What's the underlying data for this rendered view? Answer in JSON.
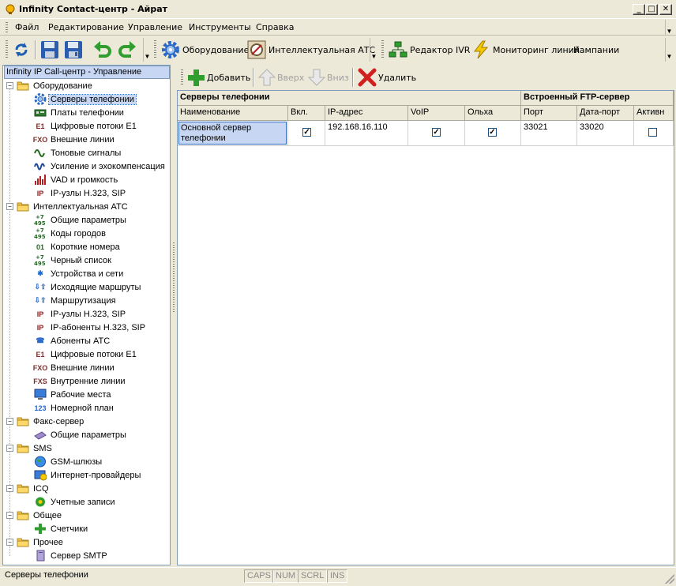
{
  "window": {
    "title": "Infinity Contact-центр  - Айрат",
    "minimize": "_",
    "maximize": "□",
    "close": "✕"
  },
  "menu": [
    "Файл",
    "Редактирование",
    "Управление",
    "Инструменты",
    "Справка"
  ],
  "toolbar": {
    "equipment": "Оборудование",
    "pbx": "Интеллектуальная АТС",
    "ivr": "Редактор IVR",
    "monitoring": "Мониторинг линий",
    "campaigns": "Кампании"
  },
  "tree": {
    "header": "Infinity IP Call-центр - Управление",
    "groups": [
      {
        "label": "Оборудование",
        "items": [
          {
            "label": "Серверы телефонии",
            "icon": "gear-icon",
            "selected": true
          },
          {
            "label": "Платы телефонии",
            "icon": "board-icon"
          },
          {
            "label": "Цифровые потоки E1",
            "icon": "e1-icon",
            "glyph": "E1"
          },
          {
            "label": "Внешние линии",
            "icon": "fxo-icon",
            "glyph": "FXO"
          },
          {
            "label": "Тоновые сигналы",
            "icon": "tone-wave-icon"
          },
          {
            "label": "Усиление и эхокомпенсация",
            "icon": "echo-icon"
          },
          {
            "label": "VAD и громкость",
            "icon": "volume-icon"
          },
          {
            "label": "IP-узлы H.323, SIP",
            "icon": "ip-icon",
            "glyph": "IP"
          }
        ]
      },
      {
        "label": "Интеллектуальная АТС",
        "items": [
          {
            "label": "Общие параметры",
            "icon": "code-495-icon"
          },
          {
            "label": "Коды городов",
            "icon": "code-495-icon"
          },
          {
            "label": "Короткие номера",
            "icon": "short-number-icon",
            "glyph": "01"
          },
          {
            "label": "Черный список",
            "icon": "code-495-icon"
          },
          {
            "label": "Устройства и сети",
            "icon": "asterisk-icon",
            "glyph": "✱"
          },
          {
            "label": "Исходящие маршруты",
            "icon": "route-icon",
            "glyph": "⇩⇧"
          },
          {
            "label": "Маршрутизация",
            "icon": "route-icon",
            "glyph": "⇩⇧"
          },
          {
            "label": "IP-узлы H.323, SIP",
            "icon": "ip-icon",
            "glyph": "IP"
          },
          {
            "label": "IP-абоненты H.323, SIP",
            "icon": "ip-phone-icon",
            "glyph": "IP"
          },
          {
            "label": "Абоненты АТС",
            "icon": "phone-icon",
            "glyph": "☎"
          },
          {
            "label": "Цифровые потоки E1",
            "icon": "e1-icon",
            "glyph": "E1"
          },
          {
            "label": "Внешние линии",
            "icon": "fxo-icon",
            "glyph": "FXO"
          },
          {
            "label": "Внутренние линии",
            "icon": "fxs-icon",
            "glyph": "FXS"
          },
          {
            "label": "Рабочие места",
            "icon": "monitor-icon"
          },
          {
            "label": "Номерной план",
            "icon": "number-plan-icon",
            "glyph": "123"
          }
        ]
      },
      {
        "label": "Факс-сервер",
        "items": [
          {
            "label": "Общие параметры",
            "icon": "fax-icon"
          }
        ]
      },
      {
        "label": "SMS",
        "items": [
          {
            "label": "GSM-шлюзы",
            "icon": "globe-icon"
          },
          {
            "label": "Интернет-провайдеры",
            "icon": "globe-monitor-icon"
          }
        ]
      },
      {
        "label": "ICQ",
        "items": [
          {
            "label": "Учетные записи",
            "icon": "icq-flower-icon"
          }
        ]
      },
      {
        "label": "Общее",
        "items": [
          {
            "label": "Счетчики",
            "icon": "plus-icon"
          }
        ]
      },
      {
        "label": "Прочее",
        "items": [
          {
            "label": "Сервер SMTP",
            "icon": "server-icon"
          }
        ]
      }
    ]
  },
  "actions": {
    "add": "Добавить",
    "up": "Вверх",
    "down": "Вниз",
    "delete": "Удалить"
  },
  "grid": {
    "group_servers": "Серверы телефонии",
    "group_ftp": "Встроенный FTP-сервер",
    "columns": [
      "Наименование",
      "Вкл.",
      "IP-адрес",
      "VoIP",
      "Ольха",
      "Порт",
      "Дата-порт",
      "Активн"
    ],
    "rows": [
      {
        "name": "Основной сервер телефонии",
        "enabled": true,
        "ip": "192.168.16.110",
        "voip": true,
        "olkha": true,
        "port": "33021",
        "data_port": "33020",
        "active": false
      }
    ]
  },
  "status": {
    "text": "Серверы телефонии",
    "caps": "CAPS",
    "num": "NUM",
    "scrl": "SCRL",
    "ins": "INS"
  },
  "colors": {
    "selection": "#c7d7f3",
    "folder": "#f5c850",
    "green": "#2f9e2f",
    "delete_red": "#d22020"
  }
}
